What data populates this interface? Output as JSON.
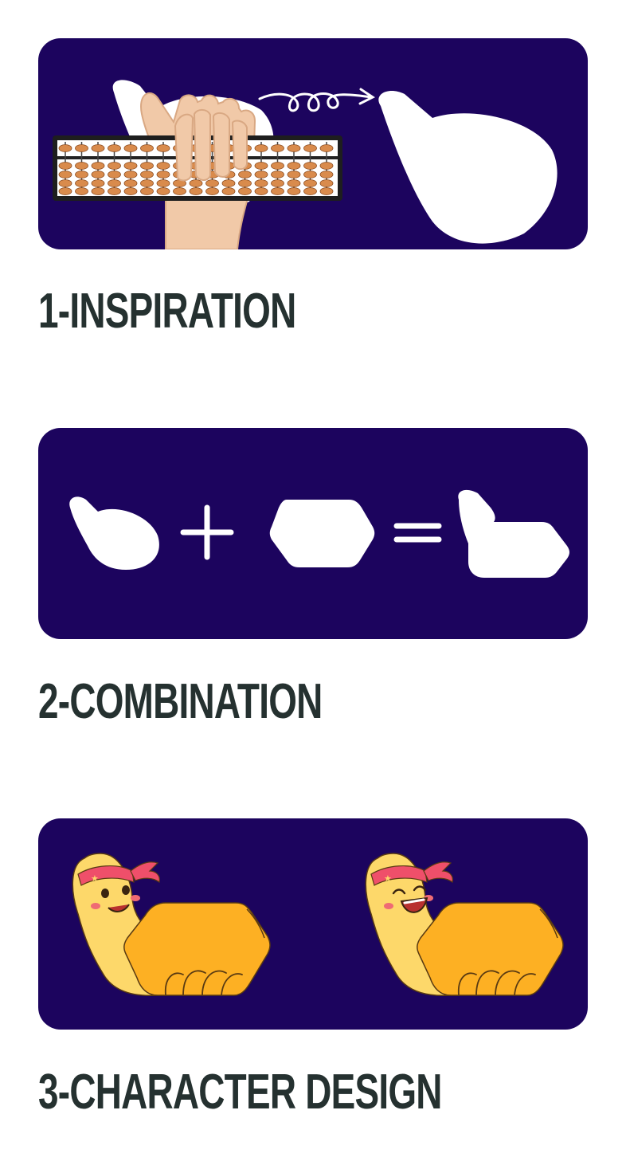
{
  "sections": [
    {
      "title": "1-INSPIRATION"
    },
    {
      "title": "2-COMBINATION"
    },
    {
      "title": "3-CHARACTER DESIGN"
    }
  ],
  "colors": {
    "panel_bg": "#1c045e",
    "heading": "#253130",
    "shape_white": "#ffffff",
    "character_yellow": "#fdd86a",
    "character_orange": "#fdb023",
    "headband_pink": "#ef4f6a"
  },
  "icons": [
    "abacus-icon",
    "hand-icon",
    "arrow-icon",
    "thumb-shape-icon",
    "plus-icon",
    "hexagon-icon",
    "equals-icon",
    "mascot-icon"
  ]
}
